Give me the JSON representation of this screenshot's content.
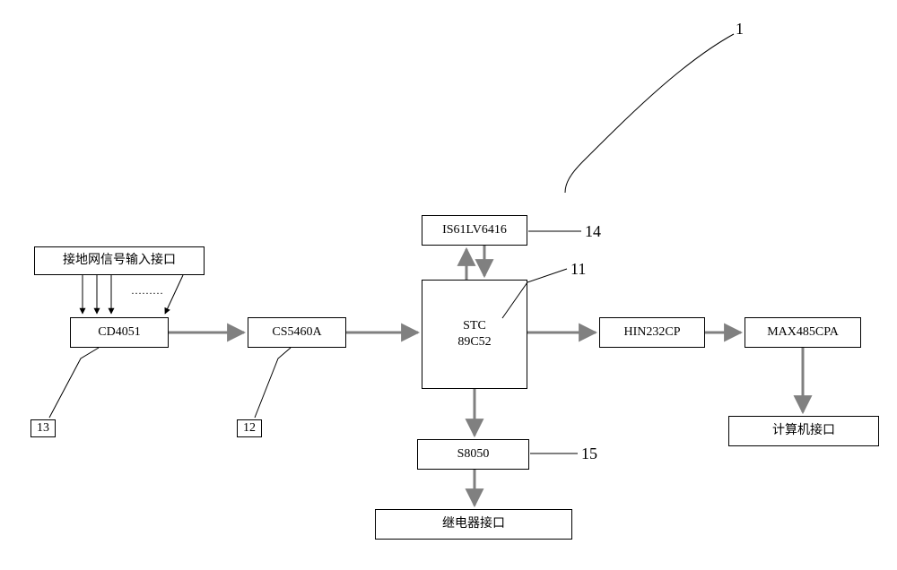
{
  "blocks": {
    "input_if": "接地网信号输入接口",
    "cd4051": "CD4051",
    "cs5460a": "CS5460A",
    "stc": "STC\n89C52",
    "is61": "IS61LV6416",
    "s8050": "S8050",
    "hin232": "HIN232CP",
    "max485": "MAX485CPA",
    "computer_if": "计算机接口",
    "relay_if": "继电器接口"
  },
  "callouts": {
    "one": "1",
    "r11": "11",
    "r12": "12",
    "r13": "13",
    "r14": "14",
    "r15": "15"
  }
}
